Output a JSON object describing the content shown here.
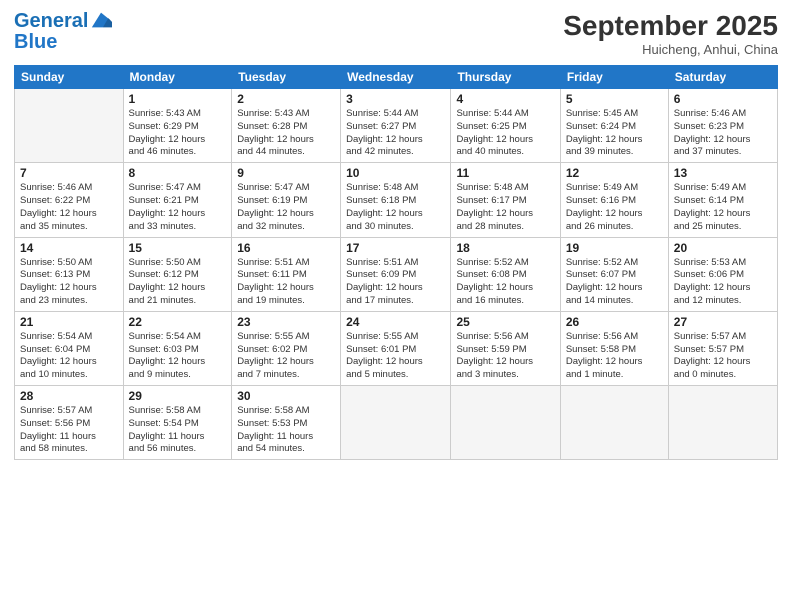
{
  "header": {
    "logo_line1": "General",
    "logo_line2": "Blue",
    "month": "September 2025",
    "location": "Huicheng, Anhui, China"
  },
  "weekdays": [
    "Sunday",
    "Monday",
    "Tuesday",
    "Wednesday",
    "Thursday",
    "Friday",
    "Saturday"
  ],
  "weeks": [
    [
      {
        "day": "",
        "info": ""
      },
      {
        "day": "1",
        "info": "Sunrise: 5:43 AM\nSunset: 6:29 PM\nDaylight: 12 hours\nand 46 minutes."
      },
      {
        "day": "2",
        "info": "Sunrise: 5:43 AM\nSunset: 6:28 PM\nDaylight: 12 hours\nand 44 minutes."
      },
      {
        "day": "3",
        "info": "Sunrise: 5:44 AM\nSunset: 6:27 PM\nDaylight: 12 hours\nand 42 minutes."
      },
      {
        "day": "4",
        "info": "Sunrise: 5:44 AM\nSunset: 6:25 PM\nDaylight: 12 hours\nand 40 minutes."
      },
      {
        "day": "5",
        "info": "Sunrise: 5:45 AM\nSunset: 6:24 PM\nDaylight: 12 hours\nand 39 minutes."
      },
      {
        "day": "6",
        "info": "Sunrise: 5:46 AM\nSunset: 6:23 PM\nDaylight: 12 hours\nand 37 minutes."
      }
    ],
    [
      {
        "day": "7",
        "info": "Sunrise: 5:46 AM\nSunset: 6:22 PM\nDaylight: 12 hours\nand 35 minutes."
      },
      {
        "day": "8",
        "info": "Sunrise: 5:47 AM\nSunset: 6:21 PM\nDaylight: 12 hours\nand 33 minutes."
      },
      {
        "day": "9",
        "info": "Sunrise: 5:47 AM\nSunset: 6:19 PM\nDaylight: 12 hours\nand 32 minutes."
      },
      {
        "day": "10",
        "info": "Sunrise: 5:48 AM\nSunset: 6:18 PM\nDaylight: 12 hours\nand 30 minutes."
      },
      {
        "day": "11",
        "info": "Sunrise: 5:48 AM\nSunset: 6:17 PM\nDaylight: 12 hours\nand 28 minutes."
      },
      {
        "day": "12",
        "info": "Sunrise: 5:49 AM\nSunset: 6:16 PM\nDaylight: 12 hours\nand 26 minutes."
      },
      {
        "day": "13",
        "info": "Sunrise: 5:49 AM\nSunset: 6:14 PM\nDaylight: 12 hours\nand 25 minutes."
      }
    ],
    [
      {
        "day": "14",
        "info": "Sunrise: 5:50 AM\nSunset: 6:13 PM\nDaylight: 12 hours\nand 23 minutes."
      },
      {
        "day": "15",
        "info": "Sunrise: 5:50 AM\nSunset: 6:12 PM\nDaylight: 12 hours\nand 21 minutes."
      },
      {
        "day": "16",
        "info": "Sunrise: 5:51 AM\nSunset: 6:11 PM\nDaylight: 12 hours\nand 19 minutes."
      },
      {
        "day": "17",
        "info": "Sunrise: 5:51 AM\nSunset: 6:09 PM\nDaylight: 12 hours\nand 17 minutes."
      },
      {
        "day": "18",
        "info": "Sunrise: 5:52 AM\nSunset: 6:08 PM\nDaylight: 12 hours\nand 16 minutes."
      },
      {
        "day": "19",
        "info": "Sunrise: 5:52 AM\nSunset: 6:07 PM\nDaylight: 12 hours\nand 14 minutes."
      },
      {
        "day": "20",
        "info": "Sunrise: 5:53 AM\nSunset: 6:06 PM\nDaylight: 12 hours\nand 12 minutes."
      }
    ],
    [
      {
        "day": "21",
        "info": "Sunrise: 5:54 AM\nSunset: 6:04 PM\nDaylight: 12 hours\nand 10 minutes."
      },
      {
        "day": "22",
        "info": "Sunrise: 5:54 AM\nSunset: 6:03 PM\nDaylight: 12 hours\nand 9 minutes."
      },
      {
        "day": "23",
        "info": "Sunrise: 5:55 AM\nSunset: 6:02 PM\nDaylight: 12 hours\nand 7 minutes."
      },
      {
        "day": "24",
        "info": "Sunrise: 5:55 AM\nSunset: 6:01 PM\nDaylight: 12 hours\nand 5 minutes."
      },
      {
        "day": "25",
        "info": "Sunrise: 5:56 AM\nSunset: 5:59 PM\nDaylight: 12 hours\nand 3 minutes."
      },
      {
        "day": "26",
        "info": "Sunrise: 5:56 AM\nSunset: 5:58 PM\nDaylight: 12 hours\nand 1 minute."
      },
      {
        "day": "27",
        "info": "Sunrise: 5:57 AM\nSunset: 5:57 PM\nDaylight: 12 hours\nand 0 minutes."
      }
    ],
    [
      {
        "day": "28",
        "info": "Sunrise: 5:57 AM\nSunset: 5:56 PM\nDaylight: 11 hours\nand 58 minutes."
      },
      {
        "day": "29",
        "info": "Sunrise: 5:58 AM\nSunset: 5:54 PM\nDaylight: 11 hours\nand 56 minutes."
      },
      {
        "day": "30",
        "info": "Sunrise: 5:58 AM\nSunset: 5:53 PM\nDaylight: 11 hours\nand 54 minutes."
      },
      {
        "day": "",
        "info": ""
      },
      {
        "day": "",
        "info": ""
      },
      {
        "day": "",
        "info": ""
      },
      {
        "day": "",
        "info": ""
      }
    ]
  ]
}
